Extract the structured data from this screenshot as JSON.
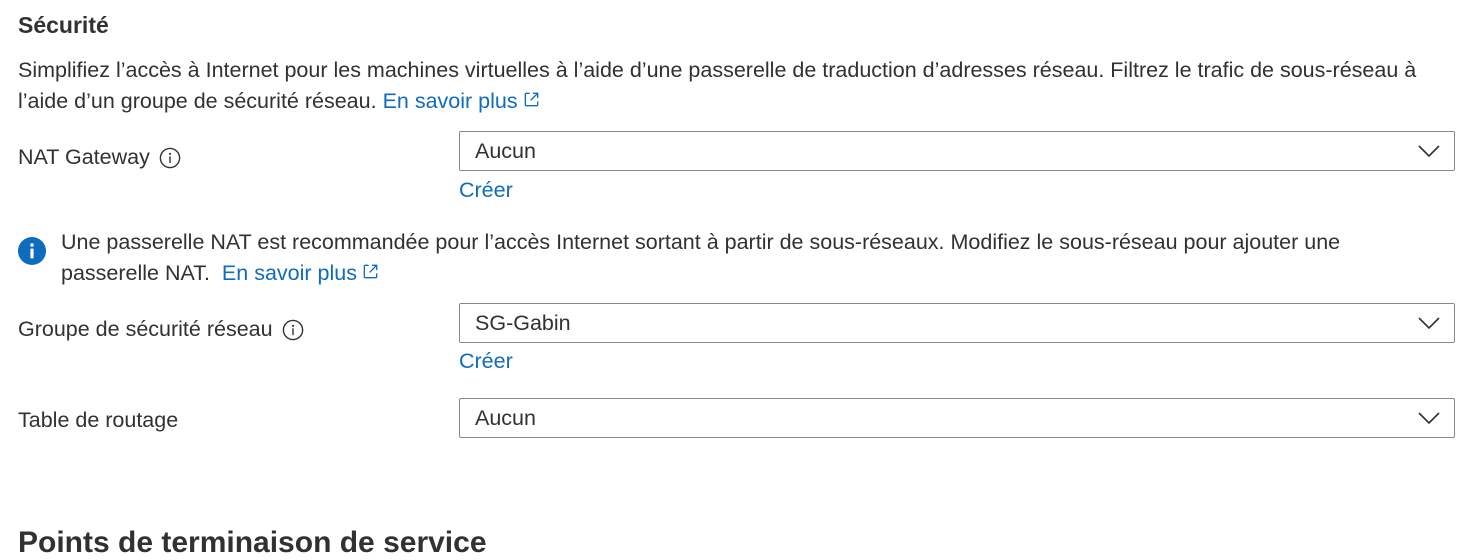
{
  "section": {
    "title": "Sécurité",
    "description": "Simplifiez l’accès à Internet pour les machines virtuelles à l’aide d’une passerelle de traduction d’adresses réseau. Filtrez le trafic de sous-réseau à l’aide d’un groupe de sécurité réseau.",
    "learn_more": "En savoir plus"
  },
  "nat_gateway": {
    "label": "NAT Gateway",
    "value": "Aucun",
    "create_label": "Créer"
  },
  "info_banner": {
    "text": "Une passerelle NAT est recommandée pour l’accès Internet sortant à partir de sous-réseaux. Modifiez le sous-réseau pour ajouter une passerelle NAT.",
    "learn_more": "En savoir plus"
  },
  "nsg": {
    "label": "Groupe de sécurité réseau",
    "value": "SG-Gabin",
    "create_label": "Créer"
  },
  "route_table": {
    "label": "Table de routage",
    "value": "Aucun"
  },
  "next_section": {
    "title": "Points de terminaison de service"
  },
  "colors": {
    "link": "#0f6cbd",
    "text": "#323130",
    "border": "#8a8886",
    "info_icon": "#0f6cbd"
  },
  "icons": {
    "info": "info-circle-icon",
    "external": "external-link-icon",
    "chevron": "chevron-down-icon",
    "banner": "info-filled-icon"
  }
}
